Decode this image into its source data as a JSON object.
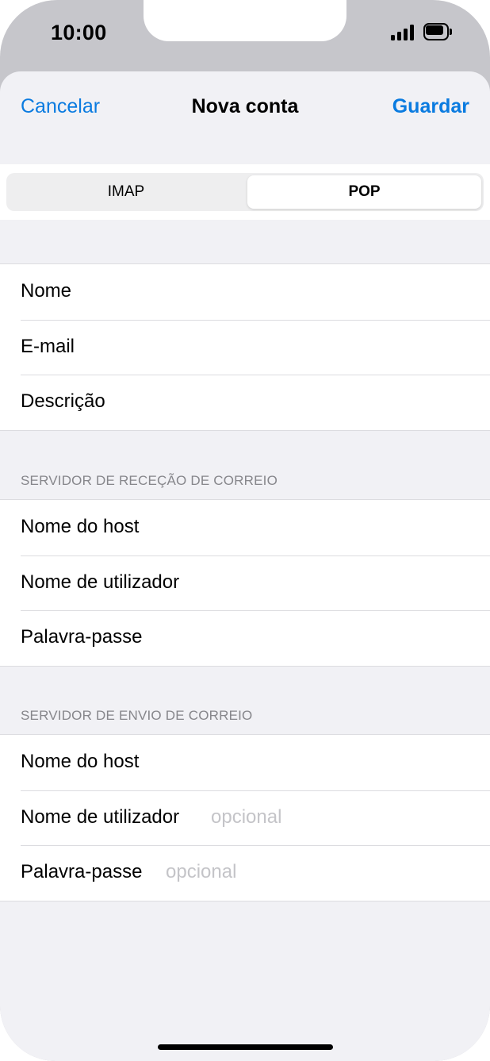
{
  "status_bar": {
    "time": "10:00"
  },
  "nav": {
    "cancel": "Cancelar",
    "title": "Nova conta",
    "save": "Guardar"
  },
  "segmented": {
    "options": [
      "IMAP",
      "POP"
    ],
    "selected": "POP"
  },
  "account": {
    "name_label": "Nome",
    "email_label": "E-mail",
    "description_label": "Descrição"
  },
  "incoming": {
    "header": "SERVIDOR DE RECEÇÃO DE CORREIO",
    "host_label": "Nome do host",
    "username_label": "Nome de utilizador",
    "password_label": "Palavra-passe"
  },
  "outgoing": {
    "header": "SERVIDOR DE ENVIO DE CORREIO",
    "host_label": "Nome do host",
    "username_label": "Nome de utilizador",
    "username_placeholder": "opcional",
    "password_label": "Palavra-passe",
    "password_placeholder": "opcional"
  },
  "colors": {
    "accent": "#0a7be0",
    "background": "#f1f1f5",
    "frame": "#c6c6cb"
  }
}
